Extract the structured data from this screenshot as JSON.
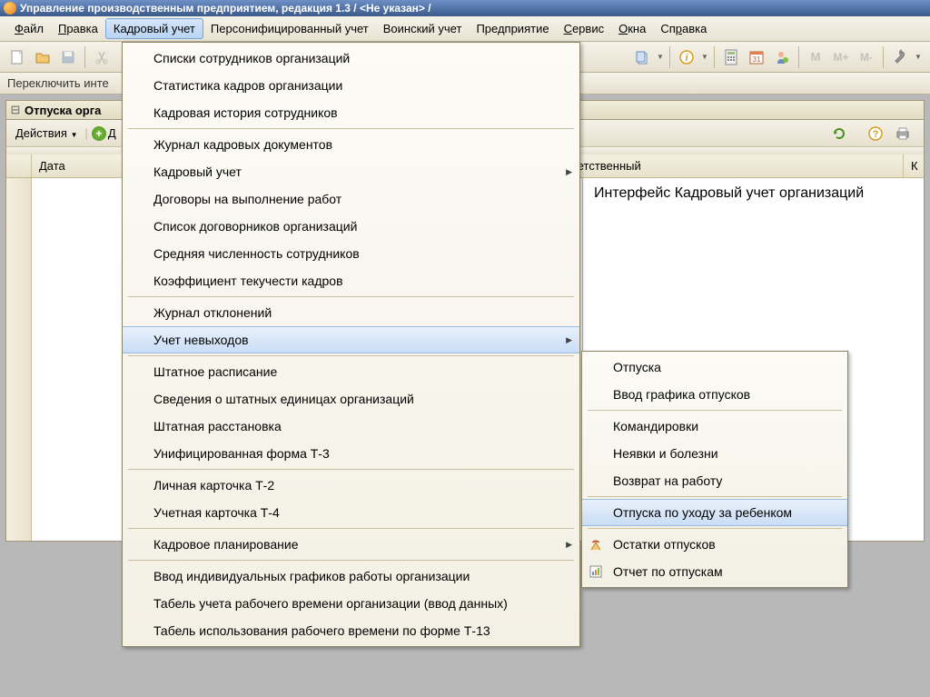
{
  "window_title": "Управление производственным предприятием, редакция 1.3 / <Не указан> /",
  "menu": {
    "file": "Файл",
    "edit": "Правка",
    "hr": "Кадровый учет",
    "pers": "Персонифицированный учет",
    "mil": "Воинский учет",
    "company": "Предприятие",
    "service": "Сервис",
    "windows": "Окна",
    "help": "Справка"
  },
  "switch_label": "Переключить инте",
  "doc_title": "Отпуска орга",
  "doc_toolbar": {
    "actions": "Действия",
    "add": "Д"
  },
  "table": {
    "date": "Дата",
    "responsible": "тветственный",
    "last": "К"
  },
  "panel_text": "Интерфейс Кадровый учет организаций",
  "main_menu": [
    {
      "label": "Списки сотрудников организаций"
    },
    {
      "label": "Статистика кадров организации"
    },
    {
      "label": "Кадровая история сотрудников"
    },
    {
      "sep": true
    },
    {
      "label": "Журнал кадровых документов"
    },
    {
      "label": "Кадровый учет",
      "arrow": true
    },
    {
      "label": "Договоры на выполнение работ"
    },
    {
      "label": "Список договорников организаций"
    },
    {
      "label": "Средняя численность сотрудников"
    },
    {
      "label": "Коэффициент текучести кадров"
    },
    {
      "sep": true
    },
    {
      "label": "Журнал отклонений"
    },
    {
      "label": "Учет невыходов",
      "arrow": true,
      "hover": true
    },
    {
      "sep": true
    },
    {
      "label": "Штатное расписание"
    },
    {
      "label": "Сведения о штатных единицах организаций"
    },
    {
      "label": "Штатная расстановка"
    },
    {
      "label": "Унифицированная форма Т-3"
    },
    {
      "sep": true
    },
    {
      "label": "Личная карточка Т-2"
    },
    {
      "label": "Учетная карточка Т-4"
    },
    {
      "sep": true
    },
    {
      "label": "Кадровое планирование",
      "arrow": true
    },
    {
      "sep": true
    },
    {
      "label": "Ввод индивидуальных графиков работы организации"
    },
    {
      "label": "Табель учета рабочего времени организации (ввод данных)"
    },
    {
      "label": "Табель использования рабочего времени по форме Т-13"
    }
  ],
  "submenu": [
    {
      "label": "Отпуска"
    },
    {
      "label": "Ввод графика отпусков"
    },
    {
      "sep": true
    },
    {
      "label": "Командировки"
    },
    {
      "label": "Неявки и болезни"
    },
    {
      "label": "Возврат на работу"
    },
    {
      "sep": true
    },
    {
      "label": "Отпуска по уходу за ребенком",
      "hover": true
    },
    {
      "sep": true
    },
    {
      "label": "Остатки отпусков",
      "icon": "vacation-balance"
    },
    {
      "label": "Отчет по отпускам",
      "icon": "vacation-report"
    }
  ]
}
